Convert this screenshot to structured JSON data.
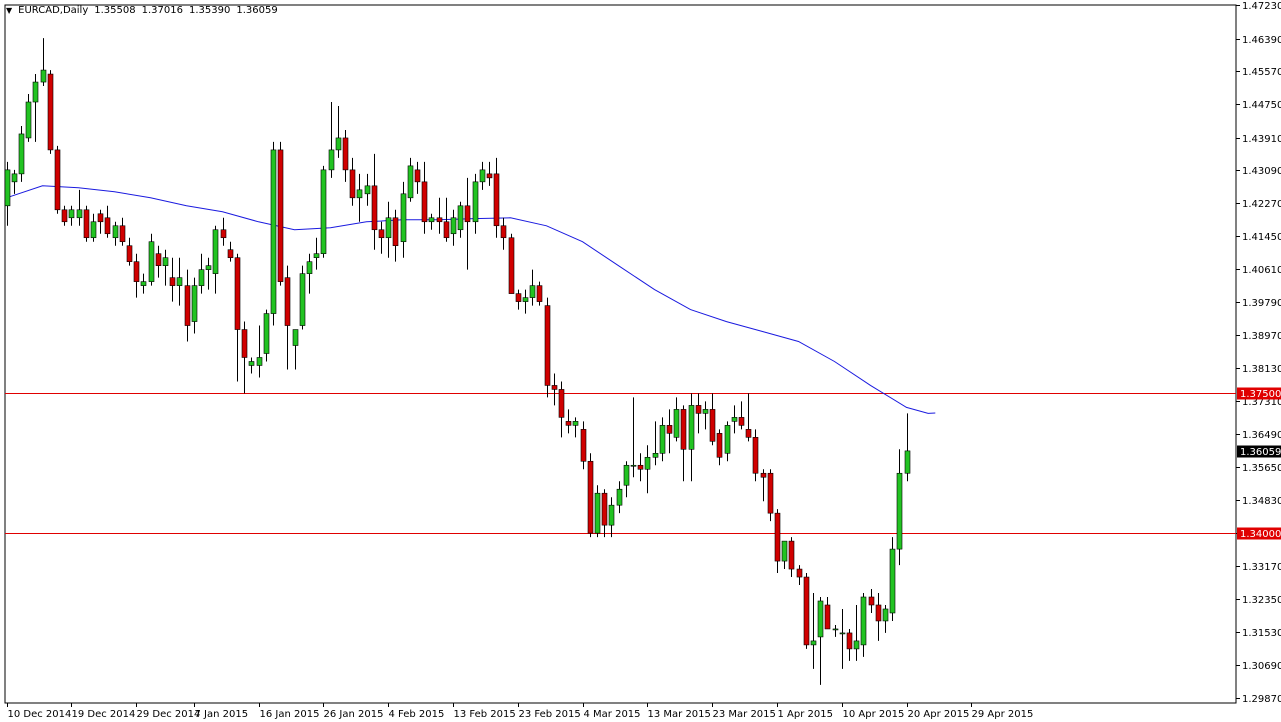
{
  "header": {
    "symbol": "EURCAD,Daily",
    "open": "1.35508",
    "high": "1.37016",
    "low": "1.35390",
    "close": "1.36059"
  },
  "colors": {
    "background": "#ffffff",
    "bull_candle": "#22c322",
    "bear_candle": "#d00000",
    "wick": "#000000",
    "moving_average": "#1a1adf",
    "horizontal_line": "#e00000",
    "frame": "#000000"
  },
  "chart_data": {
    "type": "candlestick",
    "ylim": [
      1.2987,
      1.4723
    ],
    "y_tick_labels": [
      "1.47230",
      "1.46390",
      "1.45570",
      "1.44750",
      "1.43910",
      "1.43090",
      "1.42270",
      "1.41450",
      "1.40610",
      "1.39790",
      "1.38970",
      "1.38130",
      "1.37310",
      "1.36490",
      "1.35650",
      "1.34830",
      "1.34010",
      "1.33170",
      "1.32350",
      "1.31530",
      "1.30690",
      "1.29870"
    ],
    "x_tick_labels": [
      "10 Dec 2014",
      "19 Dec 2014",
      "29 Dec 2014",
      "7 Jan 2015",
      "16 Jan 2015",
      "26 Jan 2015",
      "4 Feb 2015",
      "13 Feb 2015",
      "23 Feb 2015",
      "4 Mar 2015",
      "13 Mar 2015",
      "23 Mar 2015",
      "1 Apr 2015",
      "10 Apr 2015",
      "20 Apr 2015",
      "29 Apr 2015"
    ],
    "x_tick_candle_index": [
      0,
      9,
      18,
      26,
      35,
      44,
      53,
      62,
      71,
      80,
      89,
      98,
      107,
      116,
      125,
      134
    ],
    "candles": [
      [
        1.422,
        1.433,
        1.417,
        1.431
      ],
      [
        1.428,
        1.431,
        1.425,
        1.43
      ],
      [
        1.43,
        1.442,
        1.428,
        1.44
      ],
      [
        1.439,
        1.45,
        1.438,
        1.448
      ],
      [
        1.448,
        1.455,
        1.438,
        1.453
      ],
      [
        1.453,
        1.464,
        1.452,
        1.456
      ],
      [
        1.455,
        1.456,
        1.435,
        1.436
      ],
      [
        1.436,
        1.437,
        1.42,
        1.421
      ],
      [
        1.421,
        1.422,
        1.417,
        1.418
      ],
      [
        1.419,
        1.422,
        1.417,
        1.421
      ],
      [
        1.419,
        1.426,
        1.417,
        1.421
      ],
      [
        1.421,
        1.422,
        1.413,
        1.414
      ],
      [
        1.414,
        1.42,
        1.413,
        1.418
      ],
      [
        1.42,
        1.421,
        1.415,
        1.418
      ],
      [
        1.419,
        1.422,
        1.414,
        1.415
      ],
      [
        1.414,
        1.418,
        1.412,
        1.417
      ],
      [
        1.417,
        1.419,
        1.412,
        1.413
      ],
      [
        1.412,
        1.414,
        1.407,
        1.408
      ],
      [
        1.408,
        1.41,
        1.399,
        1.403
      ],
      [
        1.402,
        1.405,
        1.4,
        1.403
      ],
      [
        1.403,
        1.415,
        1.402,
        1.413
      ],
      [
        1.41,
        1.412,
        1.404,
        1.407
      ],
      [
        1.407,
        1.411,
        1.402,
        1.409
      ],
      [
        1.404,
        1.409,
        1.398,
        1.402
      ],
      [
        1.402,
        1.409,
        1.397,
        1.404
      ],
      [
        1.402,
        1.406,
        1.388,
        1.392
      ],
      [
        1.393,
        1.404,
        1.39,
        1.402
      ],
      [
        1.402,
        1.41,
        1.4,
        1.406
      ],
      [
        1.406,
        1.409,
        1.401,
        1.407
      ],
      [
        1.405,
        1.417,
        1.4,
        1.416
      ],
      [
        1.416,
        1.419,
        1.412,
        1.414
      ],
      [
        1.411,
        1.413,
        1.408,
        1.409
      ],
      [
        1.409,
        1.41,
        1.378,
        1.391
      ],
      [
        1.391,
        1.393,
        1.375,
        1.384
      ],
      [
        1.382,
        1.384,
        1.38,
        1.383
      ],
      [
        1.382,
        1.392,
        1.379,
        1.384
      ],
      [
        1.385,
        1.396,
        1.383,
        1.395
      ],
      [
        1.395,
        1.438,
        1.392,
        1.436
      ],
      [
        1.436,
        1.438,
        1.402,
        1.403
      ],
      [
        1.404,
        1.407,
        1.381,
        1.392
      ],
      [
        1.387,
        1.391,
        1.381,
        1.391
      ],
      [
        1.392,
        1.407,
        1.391,
        1.405
      ],
      [
        1.405,
        1.41,
        1.4,
        1.408
      ],
      [
        1.409,
        1.414,
        1.406,
        1.41
      ],
      [
        1.41,
        1.432,
        1.409,
        1.431
      ],
      [
        1.431,
        1.448,
        1.429,
        1.436
      ],
      [
        1.436,
        1.447,
        1.434,
        1.439
      ],
      [
        1.439,
        1.441,
        1.428,
        1.431
      ],
      [
        1.431,
        1.434,
        1.422,
        1.424
      ],
      [
        1.424,
        1.43,
        1.418,
        1.426
      ],
      [
        1.425,
        1.43,
        1.422,
        1.427
      ],
      [
        1.427,
        1.435,
        1.411,
        1.416
      ],
      [
        1.416,
        1.418,
        1.41,
        1.414
      ],
      [
        1.414,
        1.423,
        1.409,
        1.419
      ],
      [
        1.419,
        1.421,
        1.408,
        1.412
      ],
      [
        1.413,
        1.428,
        1.409,
        1.425
      ],
      [
        1.424,
        1.434,
        1.423,
        1.432
      ],
      [
        1.431,
        1.433,
        1.425,
        1.428
      ],
      [
        1.428,
        1.433,
        1.415,
        1.418
      ],
      [
        1.418,
        1.42,
        1.416,
        1.419
      ],
      [
        1.419,
        1.424,
        1.415,
        1.418
      ],
      [
        1.418,
        1.424,
        1.413,
        1.414
      ],
      [
        1.415,
        1.421,
        1.412,
        1.419
      ],
      [
        1.416,
        1.423,
        1.414,
        1.422
      ],
      [
        1.422,
        1.429,
        1.406,
        1.418
      ],
      [
        1.418,
        1.43,
        1.415,
        1.428
      ],
      [
        1.428,
        1.433,
        1.426,
        1.431
      ],
      [
        1.43,
        1.433,
        1.427,
        1.429
      ],
      [
        1.43,
        1.434,
        1.414,
        1.417
      ],
      [
        1.417,
        1.419,
        1.411,
        1.414
      ],
      [
        1.414,
        1.415,
        1.4,
        1.4
      ],
      [
        1.4,
        1.401,
        1.396,
        1.398
      ],
      [
        1.398,
        1.401,
        1.395,
        1.399
      ],
      [
        1.399,
        1.406,
        1.397,
        1.402
      ],
      [
        1.402,
        1.403,
        1.397,
        1.398
      ],
      [
        1.397,
        1.399,
        1.374,
        1.377
      ],
      [
        1.377,
        1.38,
        1.372,
        1.376
      ],
      [
        1.376,
        1.378,
        1.364,
        1.369
      ],
      [
        1.368,
        1.371,
        1.365,
        1.367
      ],
      [
        1.367,
        1.369,
        1.364,
        1.368
      ],
      [
        1.366,
        1.368,
        1.356,
        1.358
      ],
      [
        1.358,
        1.36,
        1.339,
        1.34
      ],
      [
        1.34,
        1.352,
        1.339,
        1.35
      ],
      [
        1.35,
        1.351,
        1.339,
        1.342
      ],
      [
        1.342,
        1.349,
        1.339,
        1.347
      ],
      [
        1.347,
        1.353,
        1.345,
        1.351
      ],
      [
        1.352,
        1.358,
        1.349,
        1.357
      ],
      [
        1.357,
        1.374,
        1.354,
        1.357
      ],
      [
        1.357,
        1.36,
        1.353,
        1.356
      ],
      [
        1.356,
        1.362,
        1.35,
        1.359
      ],
      [
        1.359,
        1.368,
        1.357,
        1.36
      ],
      [
        1.36,
        1.369,
        1.358,
        1.367
      ],
      [
        1.367,
        1.371,
        1.36,
        1.365
      ],
      [
        1.364,
        1.374,
        1.363,
        1.371
      ],
      [
        1.371,
        1.372,
        1.353,
        1.361
      ],
      [
        1.361,
        1.375,
        1.353,
        1.372
      ],
      [
        1.372,
        1.375,
        1.365,
        1.37
      ],
      [
        1.37,
        1.373,
        1.366,
        1.371
      ],
      [
        1.371,
        1.375,
        1.362,
        1.363
      ],
      [
        1.365,
        1.366,
        1.357,
        1.359
      ],
      [
        1.36,
        1.368,
        1.358,
        1.367
      ],
      [
        1.368,
        1.372,
        1.365,
        1.369
      ],
      [
        1.369,
        1.373,
        1.366,
        1.367
      ],
      [
        1.366,
        1.375,
        1.363,
        1.364
      ],
      [
        1.364,
        1.366,
        1.353,
        1.355
      ],
      [
        1.355,
        1.356,
        1.348,
        1.354
      ],
      [
        1.355,
        1.356,
        1.343,
        1.345
      ],
      [
        1.345,
        1.346,
        1.33,
        1.333
      ],
      [
        1.333,
        1.338,
        1.331,
        1.338
      ],
      [
        1.338,
        1.339,
        1.329,
        1.331
      ],
      [
        1.331,
        1.332,
        1.327,
        1.329
      ],
      [
        1.329,
        1.33,
        1.311,
        1.312
      ],
      [
        1.312,
        1.325,
        1.306,
        1.313
      ],
      [
        1.314,
        1.324,
        1.302,
        1.323
      ],
      [
        1.322,
        1.324,
        1.316,
        1.316
      ],
      [
        1.316,
        1.317,
        1.314,
        1.316
      ],
      [
        1.315,
        1.321,
        1.306,
        1.315
      ],
      [
        1.315,
        1.316,
        1.308,
        1.311
      ],
      [
        1.311,
        1.322,
        1.308,
        1.313
      ],
      [
        1.312,
        1.325,
        1.309,
        1.324
      ],
      [
        1.324,
        1.326,
        1.32,
        1.322
      ],
      [
        1.322,
        1.325,
        1.313,
        1.318
      ],
      [
        1.318,
        1.322,
        1.315,
        1.321
      ],
      [
        1.32,
        1.339,
        1.318,
        1.336
      ],
      [
        1.336,
        1.361,
        1.332,
        1.355
      ],
      [
        1.355,
        1.37,
        1.353,
        1.3606
      ]
    ],
    "moving_average": [
      [
        0,
        1.424
      ],
      [
        5,
        1.427
      ],
      [
        10,
        1.4265
      ],
      [
        15,
        1.4255
      ],
      [
        20,
        1.424
      ],
      [
        25,
        1.422
      ],
      [
        30,
        1.4205
      ],
      [
        35,
        1.418
      ],
      [
        40,
        1.416
      ],
      [
        45,
        1.4165
      ],
      [
        50,
        1.418
      ],
      [
        55,
        1.4185
      ],
      [
        60,
        1.4185
      ],
      [
        65,
        1.4188
      ],
      [
        70,
        1.419
      ],
      [
        75,
        1.417
      ],
      [
        80,
        1.413
      ],
      [
        85,
        1.407
      ],
      [
        90,
        1.401
      ],
      [
        95,
        1.396
      ],
      [
        100,
        1.393
      ],
      [
        105,
        1.3905
      ],
      [
        110,
        1.388
      ],
      [
        115,
        1.383
      ],
      [
        120,
        1.377
      ],
      [
        125,
        1.3715
      ],
      [
        128,
        1.37
      ],
      [
        129,
        1.3701
      ]
    ],
    "horizontal_lines": [
      {
        "value": 1.375,
        "label": "1.37500"
      },
      {
        "value": 1.34,
        "label": "1.34000"
      }
    ],
    "current_price_label": "1.36059"
  }
}
